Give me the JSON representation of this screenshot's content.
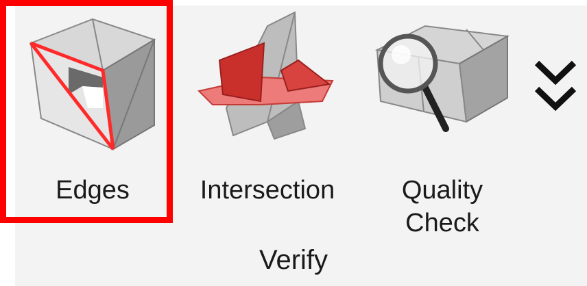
{
  "tools": [
    {
      "label": "Edges",
      "icon": "edges-cube-icon",
      "selected": true
    },
    {
      "label": "Intersection",
      "icon": "intersection-planes-icon",
      "selected": false
    },
    {
      "label": "Quality\nCheck",
      "icon": "quality-check-magnifier-icon",
      "selected": false
    }
  ],
  "overflow_icon": "double-chevron-down-icon",
  "group": {
    "label": "Verify"
  },
  "colors": {
    "highlight": "#ff0000",
    "accent_red": "#d9302c",
    "ribbon_bg": "#f3f3f3"
  }
}
